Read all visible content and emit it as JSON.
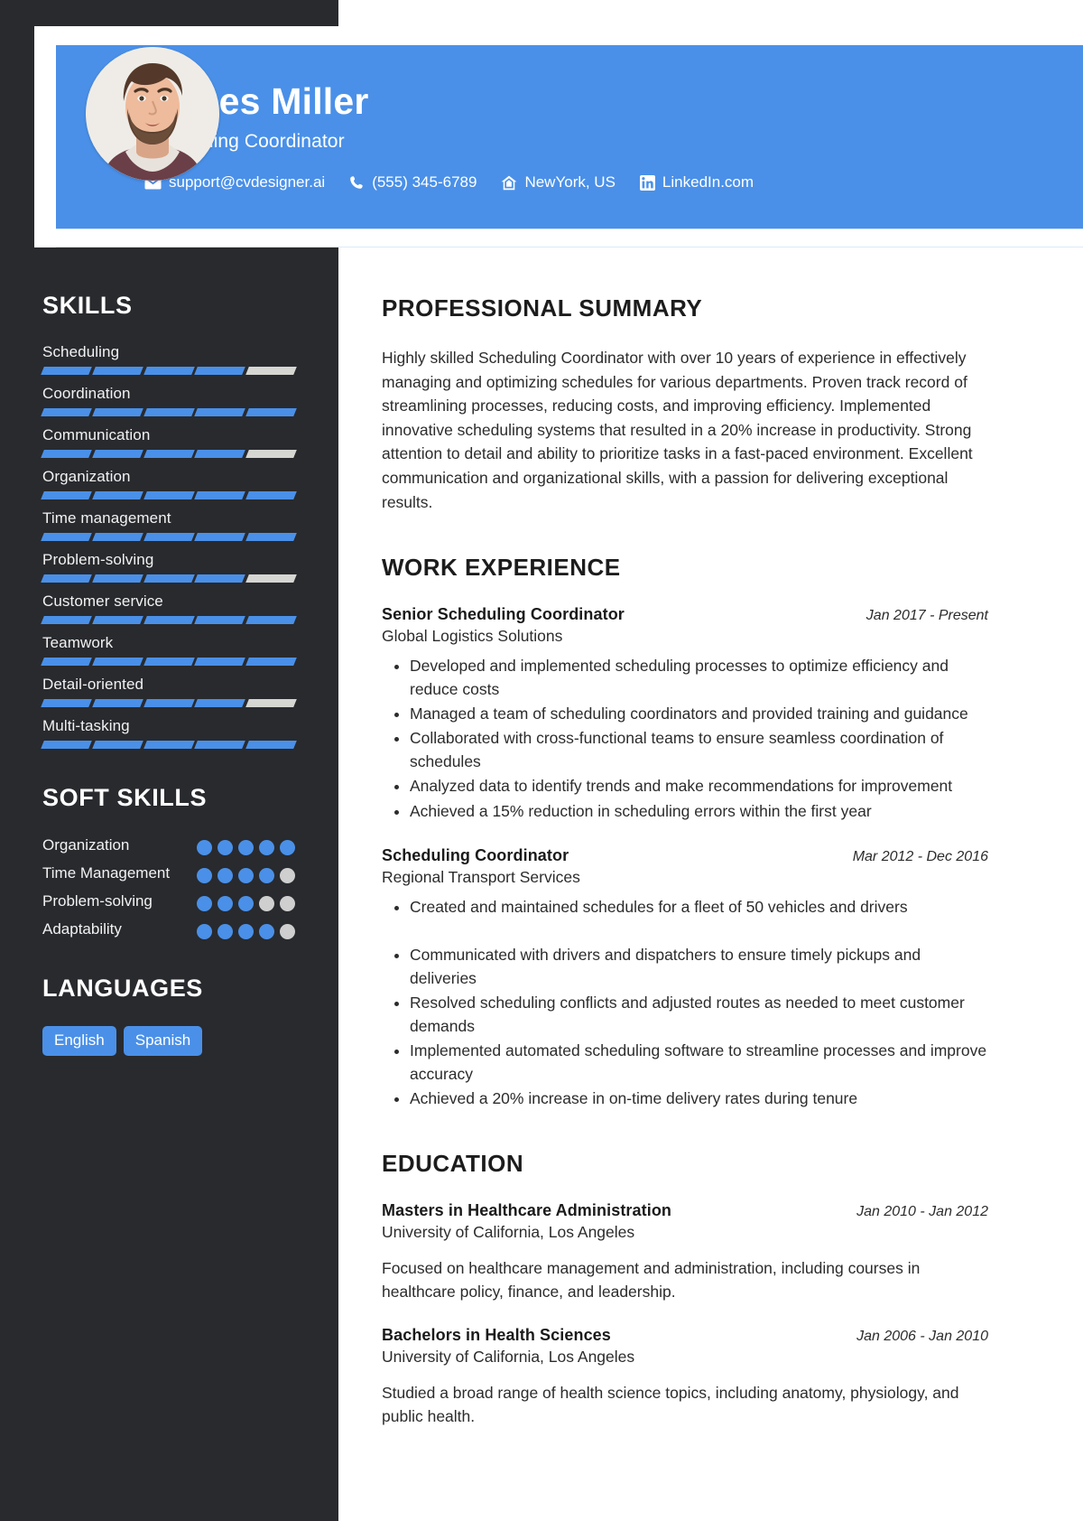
{
  "theme": {
    "accent": "#4a90e8",
    "sidebar_bg": "#282a2e",
    "bar_empty": "#d6d6d2",
    "dot_empty": "#cfcfcf"
  },
  "header": {
    "name": "James Miller",
    "role": "Scheduling Coordinator",
    "contacts": [
      {
        "icon": "envelope-icon",
        "text": "support@cvdesigner.ai"
      },
      {
        "icon": "phone-icon",
        "text": "(555) 345-6789"
      },
      {
        "icon": "home-icon",
        "text": "NewYork, US"
      },
      {
        "icon": "linkedin-icon",
        "text": "LinkedIn.com"
      }
    ]
  },
  "sidebar": {
    "skills_heading": "SKILLS",
    "skills": [
      {
        "label": "Scheduling",
        "level": 4,
        "max": 5
      },
      {
        "label": "Coordination",
        "level": 5,
        "max": 5
      },
      {
        "label": "Communication",
        "level": 4,
        "max": 5
      },
      {
        "label": "Organization",
        "level": 5,
        "max": 5
      },
      {
        "label": "Time management",
        "level": 5,
        "max": 5
      },
      {
        "label": "Problem-solving",
        "level": 4,
        "max": 5
      },
      {
        "label": "Customer service",
        "level": 5,
        "max": 5
      },
      {
        "label": "Teamwork",
        "level": 5,
        "max": 5
      },
      {
        "label": "Detail-oriented",
        "level": 4,
        "max": 5
      },
      {
        "label": "Multi-tasking",
        "level": 5,
        "max": 5
      }
    ],
    "soft_skills_heading": "SOFT SKILLS",
    "soft_skills": [
      {
        "label": "Organization",
        "level": 5,
        "max": 5
      },
      {
        "label": "Time Management",
        "level": 4,
        "max": 5
      },
      {
        "label": "Problem-solving",
        "level": 3,
        "max": 5
      },
      {
        "label": "Adaptability",
        "level": 4,
        "max": 5
      }
    ],
    "languages_heading": "LANGUAGES",
    "languages": [
      "English",
      "Spanish"
    ]
  },
  "main": {
    "summary_heading": "PROFESSIONAL SUMMARY",
    "summary": "Highly skilled Scheduling Coordinator with over 10 years of experience in effectively managing and optimizing schedules for various departments. Proven track record of streamlining processes, reducing costs, and improving efficiency. Implemented innovative scheduling systems that resulted in a 20% increase in productivity. Strong attention to detail and ability to prioritize tasks in a fast-paced environment. Excellent communication and organizational skills, with a passion for delivering exceptional results.",
    "experience_heading": "WORK EXPERIENCE",
    "experience": [
      {
        "title": "Senior Scheduling Coordinator",
        "date": "Jan 2017 - Present",
        "company": "Global Logistics Solutions",
        "bullets": [
          "Developed and implemented scheduling processes to optimize efficiency and reduce costs",
          "Managed a team of scheduling coordinators and provided training and guidance",
          "Collaborated with cross-functional teams to ensure seamless coordination of schedules",
          "Analyzed data to identify trends and make recommendations for improvement",
          "Achieved a 15% reduction in scheduling errors within the first year"
        ]
      },
      {
        "title": "Scheduling Coordinator",
        "date": "Mar 2012 - Dec 2016",
        "company": "Regional Transport Services",
        "bullets": [
          "Created and maintained schedules for a fleet of 50 vehicles and drivers",
          "Communicated with drivers and dispatchers to ensure timely pickups and deliveries",
          "Resolved scheduling conflicts and adjusted routes as needed to meet customer demands",
          "Implemented automated scheduling software to streamline processes and improve accuracy",
          "Achieved a 20% increase in on-time delivery rates during tenure"
        ]
      }
    ],
    "education_heading": "EDUCATION",
    "education": [
      {
        "degree": "Masters in Healthcare Administration",
        "date": "Jan 2010 - Jan 2012",
        "school": "University of California, Los Angeles",
        "description": "Focused on healthcare management and administration, including courses in healthcare policy, finance, and leadership."
      },
      {
        "degree": "Bachelors in Health Sciences",
        "date": "Jan 2006 - Jan 2010",
        "school": "University of California, Los Angeles",
        "description": "Studied a broad range of health science topics, including anatomy, physiology, and public health."
      }
    ]
  }
}
